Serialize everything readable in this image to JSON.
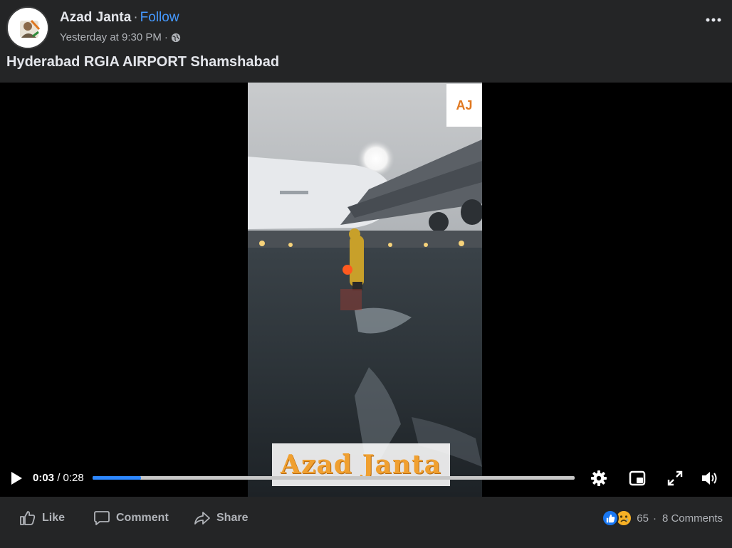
{
  "post": {
    "page_name": "Azad Janta",
    "separator": "·",
    "follow_label": "Follow",
    "timestamp": "Yesterday at 9:30 PM",
    "meta_separator": "·",
    "audience_icon": "globe-icon",
    "more_icon": "more-horizontal-icon",
    "caption": "Hyderabad RGIA AIRPORT Shamshabad"
  },
  "video": {
    "corner_badge": "AJ",
    "watermark": "Azad Janta",
    "current_time": "0:03",
    "time_separator": " / ",
    "duration": "0:28",
    "progress": 0.1,
    "controls": {
      "play_icon": "play-icon",
      "settings_icon": "gear-icon",
      "pip_icon": "picture-in-picture-icon",
      "fullscreen_icon": "expand-icon",
      "volume_icon": "volume-icon"
    }
  },
  "actions": {
    "like_label": "Like",
    "comment_label": "Comment",
    "share_label": "Share"
  },
  "reactions": {
    "types": [
      "like",
      "sad"
    ],
    "count": "65",
    "separator": "·",
    "comments_label": "8 Comments"
  },
  "colors": {
    "follow": "#4599ff",
    "progress": "#2d88ff",
    "like_reaction": "#1877f2",
    "sad_reaction": "#f7b125",
    "background": "#242526"
  }
}
